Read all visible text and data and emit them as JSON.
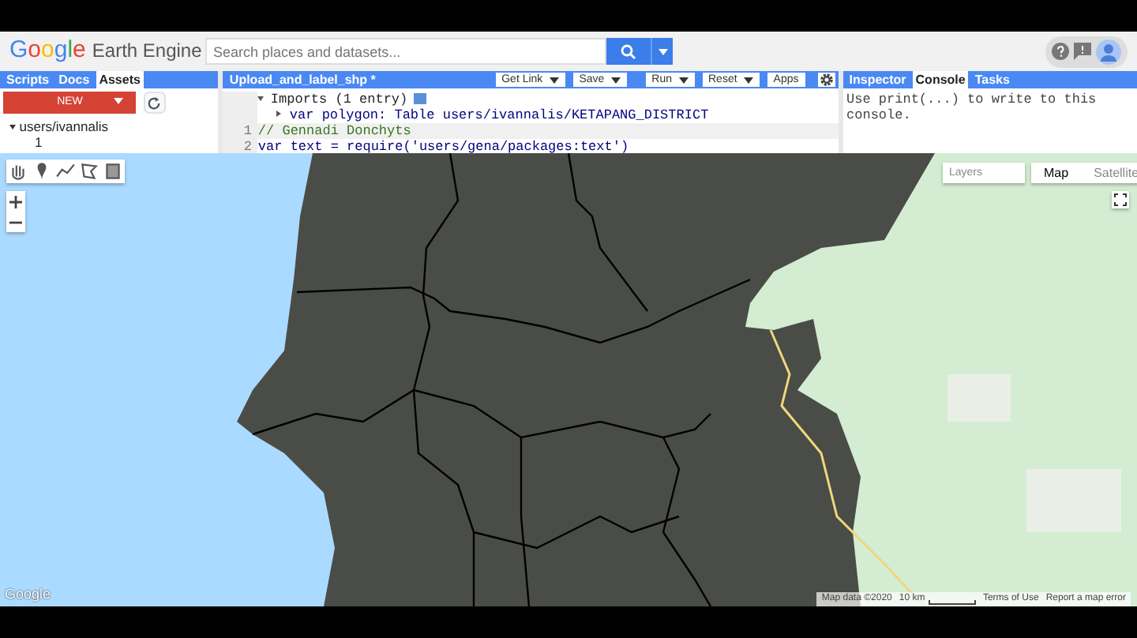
{
  "header": {
    "logo": {
      "brand": "Google",
      "product": "Earth Engine"
    },
    "search": {
      "placeholder": "Search places and datasets..."
    }
  },
  "left_panel": {
    "tabs": [
      {
        "label": "Scripts",
        "selected": false
      },
      {
        "label": "Docs",
        "selected": false
      },
      {
        "label": "Assets",
        "selected": true
      }
    ],
    "new_button": "NEW",
    "tree": [
      {
        "label": "users/ivannalis",
        "expanded": true,
        "children": [
          {
            "label": "1"
          }
        ]
      }
    ]
  },
  "editor": {
    "title": "Upload_and_label_shp *",
    "buttons": [
      {
        "label": "Get Link",
        "dropdown": true
      },
      {
        "label": "Save",
        "dropdown": true
      },
      {
        "label": "Run",
        "dropdown": true
      },
      {
        "label": "Reset",
        "dropdown": true
      },
      {
        "label": "Apps",
        "dropdown": false
      }
    ],
    "imports": {
      "label": "Imports (1 entry)",
      "expanded": true,
      "entries": [
        "var polygon: Table users/ivannalis/KETAPANG_DISTRICT"
      ]
    },
    "lines": [
      {
        "number": "1",
        "kind": "comment",
        "text": "// Gennadi Donchyts"
      },
      {
        "number": "2",
        "kind": "code",
        "text": "var text = require('users/gena/packages:text')"
      }
    ]
  },
  "right_panel": {
    "tabs": [
      {
        "label": "Inspector",
        "selected": false
      },
      {
        "label": "Console",
        "selected": true
      },
      {
        "label": "Tasks",
        "selected": false
      }
    ],
    "console_text": "Use print(...) to write to this console."
  },
  "map": {
    "layers": "Layers",
    "map_types": [
      {
        "label": "Map",
        "selected": true
      },
      {
        "label": "Satellite",
        "selected": false
      }
    ],
    "brand": "Google",
    "attribution": "Map data ©2020",
    "scale": "10 km",
    "links": [
      "Terms of Use",
      "Report a map error"
    ]
  }
}
